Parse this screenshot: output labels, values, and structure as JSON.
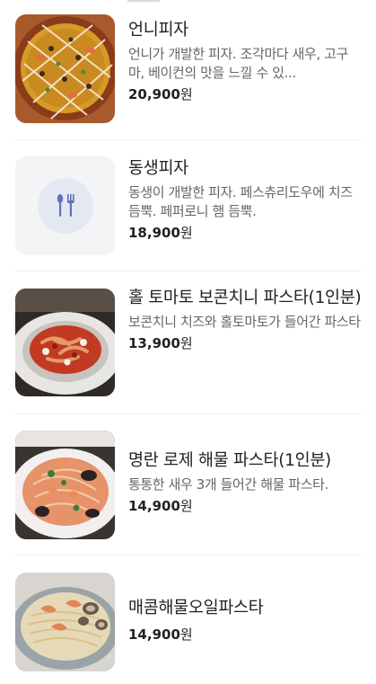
{
  "menu": {
    "items": [
      {
        "name": "언니피자",
        "description": "언니가 개발한 피자. 조각마다 새우, 고구마, 베이컨의 맛을 느낄 수 있...",
        "price": "20,900",
        "currency": "원",
        "image": "pizza-photo"
      },
      {
        "name": "동생피자",
        "description": "동생이 개발한 피자. 페스츄리도우에 치즈 듬뿍. 페퍼로니 햄 듬뿍.",
        "price": "18,900",
        "currency": "원",
        "image": "utensils-icon"
      },
      {
        "name": "홀 토마토 보콘치니 파스타(1인분)",
        "description": "보콘치니 치즈와 홀토마토가 들어간 파스타",
        "price": "13,900",
        "currency": "원",
        "image": "tomato-pasta-photo"
      },
      {
        "name": "명란 로제 해물 파스타(1인분)",
        "description": "통통한 새우 3개 들어간 해물 파스타.",
        "price": "14,900",
        "currency": "원",
        "image": "rose-seafood-pasta-photo"
      },
      {
        "name": "매콤해물오일파스타",
        "description": "",
        "price": "14,900",
        "currency": "원",
        "image": "oil-seafood-pasta-photo"
      }
    ]
  }
}
